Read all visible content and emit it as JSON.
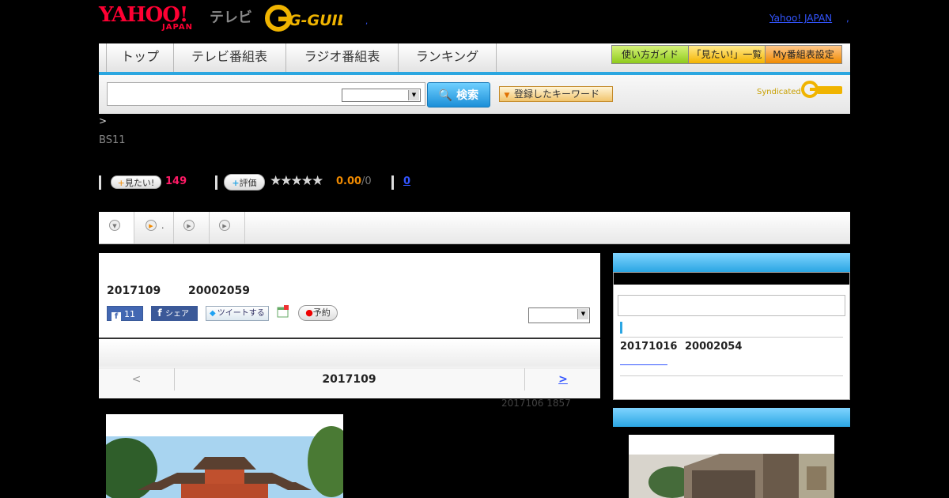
{
  "header": {
    "yahoo_logo": "YAHOO!",
    "yahoo_japan": "JAPAN",
    "tv_label": "テレビ",
    "gguide_logo": "G-GUIDE",
    "yahoo_japan_link": "Yahoo! JAPAN",
    "link_sep": ",",
    "dot": ","
  },
  "nav": {
    "tabs": [
      "トップ",
      "テレビ番組表",
      "ラジオ番組表",
      "ランキング"
    ],
    "guide_button": "使い方ガイド",
    "mitai_list_button": "「見たい!」一覧",
    "my_schedule_button": "My番組表設定"
  },
  "search": {
    "button_label": "検索",
    "keyword_button": "登録したキーワード",
    "syndicated": "Syndicated"
  },
  "program": {
    "breadcrumb": ">",
    "channel": "BS11",
    "mitai_label": "見たい!",
    "mitai_count": "149",
    "hyoka_label": "評価",
    "stars": "★★★★★",
    "score": "0.00",
    "score_count": "/0",
    "comment_count": "0"
  },
  "tabstrip": {
    "tab2_label": "."
  },
  "main": {
    "date": "2017109",
    "id": "20002059",
    "fb_like_count": "11",
    "fb_share_label": "シェア",
    "tweet_label": "ツイートする",
    "yoyaku_label": "予約",
    "pager_prev": "<",
    "pager_title": "2017109",
    "pager_next": ">",
    "updated": "2017106  1857"
  },
  "side": {
    "date": "20171016",
    "id": "20002054"
  }
}
